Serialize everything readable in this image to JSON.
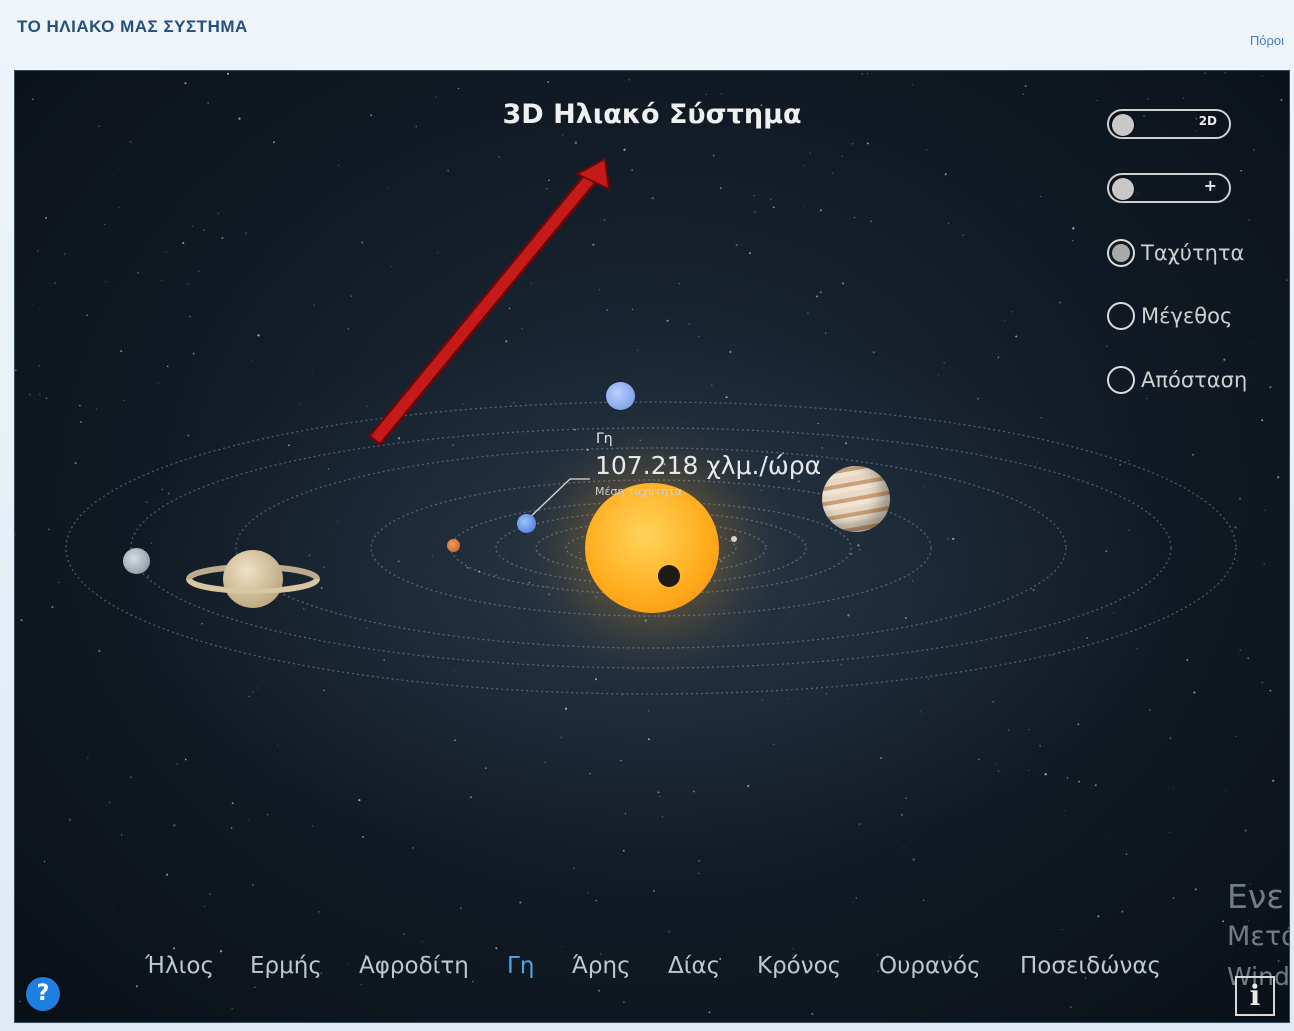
{
  "header": {
    "title": "ΤΟ ΗΛΙΑΚΟ ΜΑΣ ΣΥΣΤΗΜΑ",
    "resources_link": "Πόροι"
  },
  "viewer": {
    "title": "3D Ηλιακό Σύστημα",
    "toggles": [
      {
        "label": "2D",
        "state": "off"
      },
      {
        "label": "+",
        "state": "off"
      }
    ],
    "radio_options": [
      {
        "label": "Ταχύτητα",
        "checked": true
      },
      {
        "label": "Μέγεθος",
        "checked": false
      },
      {
        "label": "Απόσταση",
        "checked": false
      }
    ],
    "info_label": {
      "planet": "Γη",
      "value": "107.218 χλμ./ώρα",
      "caption": "Μέση ταχύτητα"
    },
    "nav": [
      {
        "label": "Ήλιος",
        "active": false
      },
      {
        "label": "Ερμής",
        "active": false
      },
      {
        "label": "Αφροδίτη",
        "active": false
      },
      {
        "label": "Γη",
        "active": true
      },
      {
        "label": "Άρης",
        "active": false
      },
      {
        "label": "Δίας",
        "active": false
      },
      {
        "label": "Κρόνος",
        "active": false
      },
      {
        "label": "Ουρανός",
        "active": false
      },
      {
        "label": "Ποσειδώνας",
        "active": false
      }
    ],
    "help_button": "?",
    "info_button": "i",
    "watermark": [
      "Ενε",
      "Μετά",
      "Wind"
    ]
  },
  "colors": {
    "header_title": "#24507a",
    "link": "#4a7fb8",
    "active_nav": "#4aa8e8",
    "help_button": "#1e7fe0",
    "annotation_arrow": "#c41a1a",
    "sun": "#ffb020"
  }
}
